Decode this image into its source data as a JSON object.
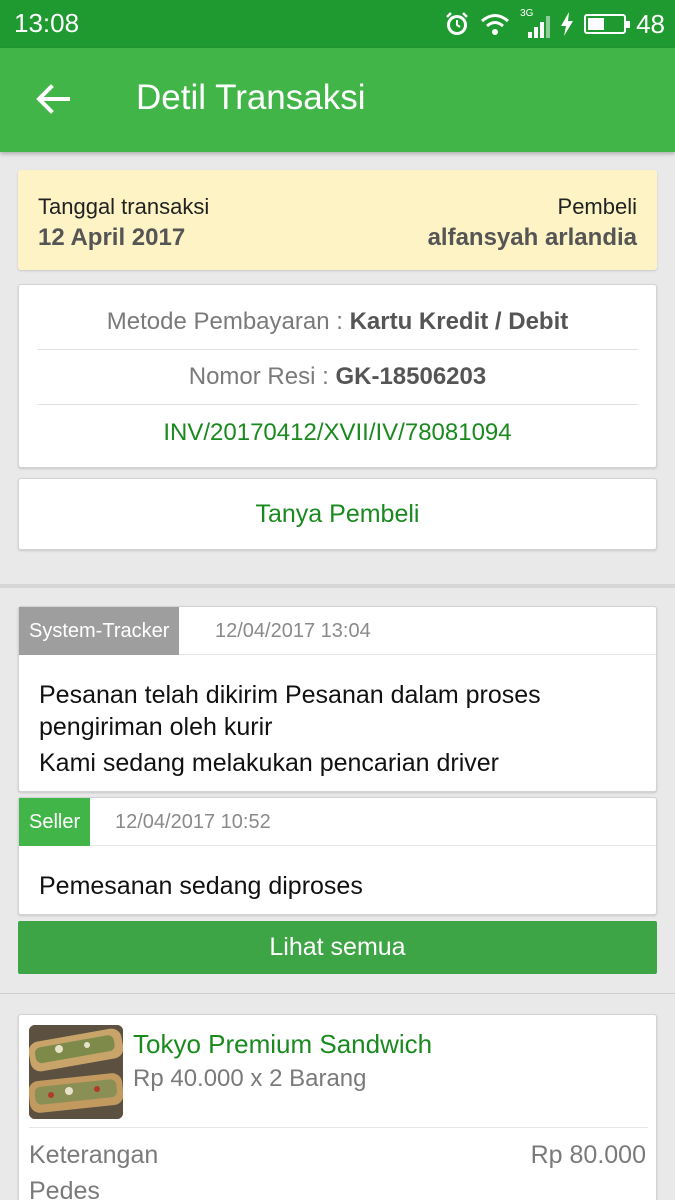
{
  "status_bar": {
    "time": "13:08",
    "network_label": "3G",
    "battery_level": "48",
    "battery_fraction": 0.48
  },
  "app_bar": {
    "title": "Detil Transaksi"
  },
  "transaction": {
    "date_label": "Tanggal transaksi",
    "date_value": "12 April 2017",
    "buyer_label": "Pembeli",
    "buyer_value": "alfansyah arlandia"
  },
  "payment": {
    "method_label": "Metode Pembayaran : ",
    "method_value": "Kartu Kredit / Debit",
    "receipt_label": "Nomor Resi : ",
    "receipt_value": "GK-18506203",
    "invoice": "INV/20170412/XVII/IV/78081094"
  },
  "ask_buyer_label": "Tanya Pembeli",
  "tracking": [
    {
      "source": "System-Tracker",
      "timestamp": "12/04/2017 13:04",
      "lines": [
        "Pesanan telah dikirim Pesanan dalam proses",
        "pengiriman oleh kurir",
        "Kami sedang melakukan pencarian driver"
      ]
    },
    {
      "source": "Seller",
      "timestamp": "12/04/2017 10:52",
      "lines": [
        "Pemesanan sedang diproses"
      ]
    }
  ],
  "see_all_label": "Lihat semua",
  "product": {
    "name": "Tokyo Premium Sandwich",
    "price_line": "Rp 40.000 x 2 Barang",
    "note_label": "Keterangan",
    "note_value": "Pedes",
    "subtotal": "Rp 80.000"
  },
  "colors": {
    "status_bar": "#1f9a30",
    "app_bar": "#42b549",
    "accent_green": "#1a8a1f",
    "button_green": "#3da545",
    "date_card_bg": "#fdf3c4",
    "tag_gray": "#9e9e9e"
  }
}
